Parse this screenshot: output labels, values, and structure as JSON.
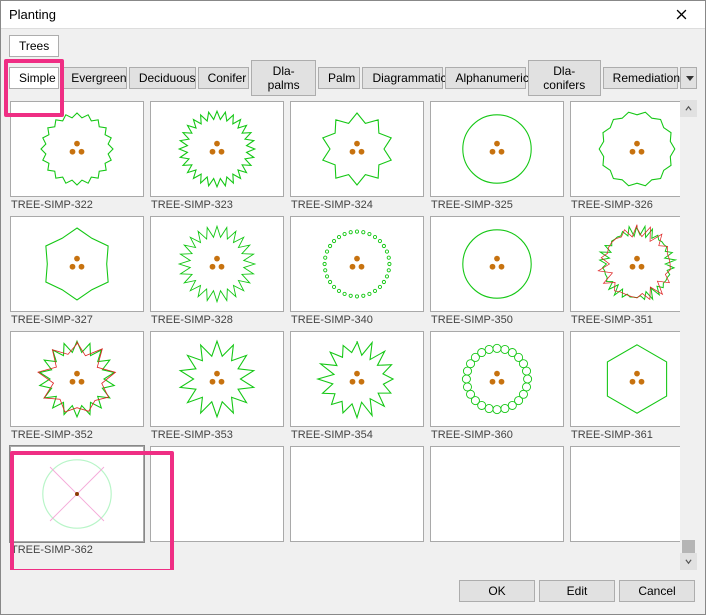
{
  "window": {
    "title": "Planting"
  },
  "tabs": {
    "row1": [
      {
        "label": "Trees",
        "active": true
      }
    ],
    "row2": [
      {
        "label": "Simple",
        "active": true
      },
      {
        "label": "Evergreen"
      },
      {
        "label": "Deciduous"
      },
      {
        "label": "Conifer"
      },
      {
        "label": "Dla-palms"
      },
      {
        "label": "Palm"
      },
      {
        "label": "Diagrammatic"
      },
      {
        "label": "Alphanumeric"
      },
      {
        "label": "Dla-conifers"
      },
      {
        "label": "Remediation"
      }
    ]
  },
  "items": [
    {
      "name": "TREE-SIMP-322",
      "style": "wavy-outer"
    },
    {
      "name": "TREE-SIMP-323",
      "style": "spiky-out"
    },
    {
      "name": "TREE-SIMP-324",
      "style": "lobed"
    },
    {
      "name": "TREE-SIMP-325",
      "style": "plain-circle"
    },
    {
      "name": "TREE-SIMP-326",
      "style": "scallop-in"
    },
    {
      "name": "TREE-SIMP-327",
      "style": "hex-lobed"
    },
    {
      "name": "TREE-SIMP-328",
      "style": "thin-spiky"
    },
    {
      "name": "TREE-SIMP-340",
      "style": "dotted-ring"
    },
    {
      "name": "TREE-SIMP-350",
      "style": "plain-circle"
    },
    {
      "name": "TREE-SIMP-351",
      "style": "rough-red"
    },
    {
      "name": "TREE-SIMP-352",
      "style": "gear-red"
    },
    {
      "name": "TREE-SIMP-353",
      "style": "star-lobed"
    },
    {
      "name": "TREE-SIMP-354",
      "style": "rough-star"
    },
    {
      "name": "TREE-SIMP-360",
      "style": "loop-ring"
    },
    {
      "name": "TREE-SIMP-361",
      "style": "hexagon"
    },
    {
      "name": "TREE-SIMP-362",
      "style": "cross-circle",
      "selected": true
    }
  ],
  "grid_columns_visible": 5,
  "footer": {
    "ok": "OK",
    "edit": "Edit",
    "cancel": "Cancel"
  }
}
